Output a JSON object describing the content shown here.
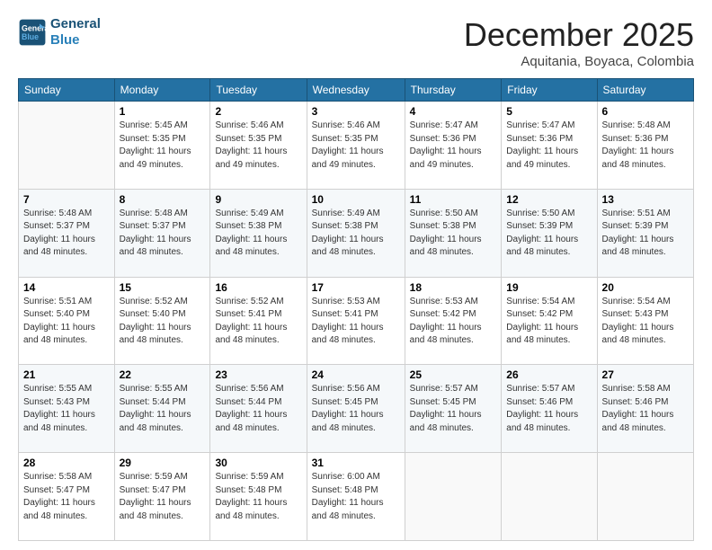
{
  "logo": {
    "line1": "General",
    "line2": "Blue"
  },
  "title": "December 2025",
  "subtitle": "Aquitania, Boyaca, Colombia",
  "header_days": [
    "Sunday",
    "Monday",
    "Tuesday",
    "Wednesday",
    "Thursday",
    "Friday",
    "Saturday"
  ],
  "weeks": [
    [
      {
        "day": "",
        "sunrise": "",
        "sunset": "",
        "daylight": ""
      },
      {
        "day": "1",
        "sunrise": "Sunrise: 5:45 AM",
        "sunset": "Sunset: 5:35 PM",
        "daylight": "Daylight: 11 hours and 49 minutes."
      },
      {
        "day": "2",
        "sunrise": "Sunrise: 5:46 AM",
        "sunset": "Sunset: 5:35 PM",
        "daylight": "Daylight: 11 hours and 49 minutes."
      },
      {
        "day": "3",
        "sunrise": "Sunrise: 5:46 AM",
        "sunset": "Sunset: 5:35 PM",
        "daylight": "Daylight: 11 hours and 49 minutes."
      },
      {
        "day": "4",
        "sunrise": "Sunrise: 5:47 AM",
        "sunset": "Sunset: 5:36 PM",
        "daylight": "Daylight: 11 hours and 49 minutes."
      },
      {
        "day": "5",
        "sunrise": "Sunrise: 5:47 AM",
        "sunset": "Sunset: 5:36 PM",
        "daylight": "Daylight: 11 hours and 49 minutes."
      },
      {
        "day": "6",
        "sunrise": "Sunrise: 5:48 AM",
        "sunset": "Sunset: 5:36 PM",
        "daylight": "Daylight: 11 hours and 48 minutes."
      }
    ],
    [
      {
        "day": "7",
        "sunrise": "Sunrise: 5:48 AM",
        "sunset": "Sunset: 5:37 PM",
        "daylight": "Daylight: 11 hours and 48 minutes."
      },
      {
        "day": "8",
        "sunrise": "Sunrise: 5:48 AM",
        "sunset": "Sunset: 5:37 PM",
        "daylight": "Daylight: 11 hours and 48 minutes."
      },
      {
        "day": "9",
        "sunrise": "Sunrise: 5:49 AM",
        "sunset": "Sunset: 5:38 PM",
        "daylight": "Daylight: 11 hours and 48 minutes."
      },
      {
        "day": "10",
        "sunrise": "Sunrise: 5:49 AM",
        "sunset": "Sunset: 5:38 PM",
        "daylight": "Daylight: 11 hours and 48 minutes."
      },
      {
        "day": "11",
        "sunrise": "Sunrise: 5:50 AM",
        "sunset": "Sunset: 5:38 PM",
        "daylight": "Daylight: 11 hours and 48 minutes."
      },
      {
        "day": "12",
        "sunrise": "Sunrise: 5:50 AM",
        "sunset": "Sunset: 5:39 PM",
        "daylight": "Daylight: 11 hours and 48 minutes."
      },
      {
        "day": "13",
        "sunrise": "Sunrise: 5:51 AM",
        "sunset": "Sunset: 5:39 PM",
        "daylight": "Daylight: 11 hours and 48 minutes."
      }
    ],
    [
      {
        "day": "14",
        "sunrise": "Sunrise: 5:51 AM",
        "sunset": "Sunset: 5:40 PM",
        "daylight": "Daylight: 11 hours and 48 minutes."
      },
      {
        "day": "15",
        "sunrise": "Sunrise: 5:52 AM",
        "sunset": "Sunset: 5:40 PM",
        "daylight": "Daylight: 11 hours and 48 minutes."
      },
      {
        "day": "16",
        "sunrise": "Sunrise: 5:52 AM",
        "sunset": "Sunset: 5:41 PM",
        "daylight": "Daylight: 11 hours and 48 minutes."
      },
      {
        "day": "17",
        "sunrise": "Sunrise: 5:53 AM",
        "sunset": "Sunset: 5:41 PM",
        "daylight": "Daylight: 11 hours and 48 minutes."
      },
      {
        "day": "18",
        "sunrise": "Sunrise: 5:53 AM",
        "sunset": "Sunset: 5:42 PM",
        "daylight": "Daylight: 11 hours and 48 minutes."
      },
      {
        "day": "19",
        "sunrise": "Sunrise: 5:54 AM",
        "sunset": "Sunset: 5:42 PM",
        "daylight": "Daylight: 11 hours and 48 minutes."
      },
      {
        "day": "20",
        "sunrise": "Sunrise: 5:54 AM",
        "sunset": "Sunset: 5:43 PM",
        "daylight": "Daylight: 11 hours and 48 minutes."
      }
    ],
    [
      {
        "day": "21",
        "sunrise": "Sunrise: 5:55 AM",
        "sunset": "Sunset: 5:43 PM",
        "daylight": "Daylight: 11 hours and 48 minutes."
      },
      {
        "day": "22",
        "sunrise": "Sunrise: 5:55 AM",
        "sunset": "Sunset: 5:44 PM",
        "daylight": "Daylight: 11 hours and 48 minutes."
      },
      {
        "day": "23",
        "sunrise": "Sunrise: 5:56 AM",
        "sunset": "Sunset: 5:44 PM",
        "daylight": "Daylight: 11 hours and 48 minutes."
      },
      {
        "day": "24",
        "sunrise": "Sunrise: 5:56 AM",
        "sunset": "Sunset: 5:45 PM",
        "daylight": "Daylight: 11 hours and 48 minutes."
      },
      {
        "day": "25",
        "sunrise": "Sunrise: 5:57 AM",
        "sunset": "Sunset: 5:45 PM",
        "daylight": "Daylight: 11 hours and 48 minutes."
      },
      {
        "day": "26",
        "sunrise": "Sunrise: 5:57 AM",
        "sunset": "Sunset: 5:46 PM",
        "daylight": "Daylight: 11 hours and 48 minutes."
      },
      {
        "day": "27",
        "sunrise": "Sunrise: 5:58 AM",
        "sunset": "Sunset: 5:46 PM",
        "daylight": "Daylight: 11 hours and 48 minutes."
      }
    ],
    [
      {
        "day": "28",
        "sunrise": "Sunrise: 5:58 AM",
        "sunset": "Sunset: 5:47 PM",
        "daylight": "Daylight: 11 hours and 48 minutes."
      },
      {
        "day": "29",
        "sunrise": "Sunrise: 5:59 AM",
        "sunset": "Sunset: 5:47 PM",
        "daylight": "Daylight: 11 hours and 48 minutes."
      },
      {
        "day": "30",
        "sunrise": "Sunrise: 5:59 AM",
        "sunset": "Sunset: 5:48 PM",
        "daylight": "Daylight: 11 hours and 48 minutes."
      },
      {
        "day": "31",
        "sunrise": "Sunrise: 6:00 AM",
        "sunset": "Sunset: 5:48 PM",
        "daylight": "Daylight: 11 hours and 48 minutes."
      },
      {
        "day": "",
        "sunrise": "",
        "sunset": "",
        "daylight": ""
      },
      {
        "day": "",
        "sunrise": "",
        "sunset": "",
        "daylight": ""
      },
      {
        "day": "",
        "sunrise": "",
        "sunset": "",
        "daylight": ""
      }
    ]
  ]
}
